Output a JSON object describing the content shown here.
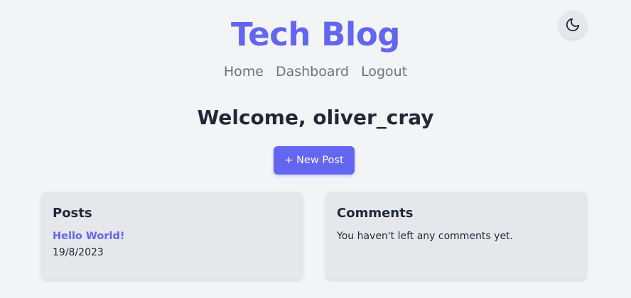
{
  "header": {
    "title": "Tech Blog",
    "theme_toggle_icon": "moon-icon"
  },
  "nav": {
    "items": [
      {
        "label": "Home"
      },
      {
        "label": "Dashboard"
      },
      {
        "label": "Logout"
      }
    ]
  },
  "main": {
    "welcome": "Welcome, oliver_cray",
    "new_post_label": "+ New Post"
  },
  "posts": {
    "title": "Posts",
    "items": [
      {
        "title": "Hello World!",
        "date": "19/8/2023"
      }
    ]
  },
  "comments": {
    "title": "Comments",
    "empty_message": "You haven't left any comments yet."
  },
  "colors": {
    "accent": "#6366f1",
    "background": "#f3f4f6",
    "card": "#e5e7eb",
    "text": "#1f2937",
    "muted": "#6b7280"
  }
}
